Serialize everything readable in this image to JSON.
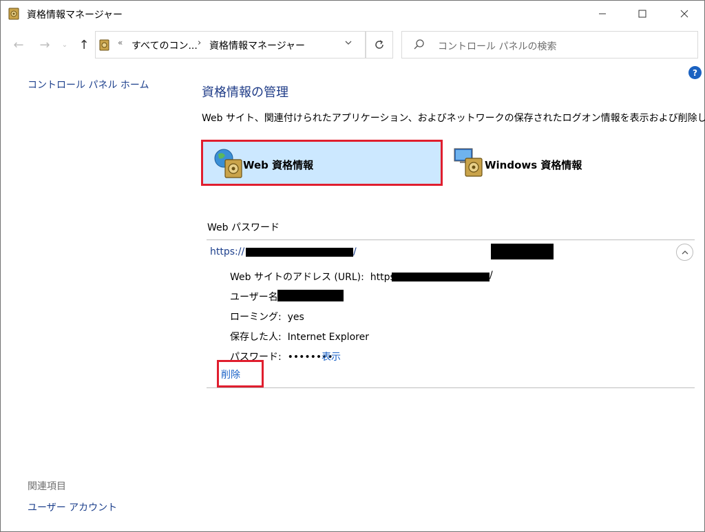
{
  "window": {
    "title": "資格情報マネージャー",
    "controls": {
      "minimize": "minimize",
      "maximize": "maximize",
      "close": "close"
    }
  },
  "address_bar": {
    "overflow_chevron": "«",
    "crumbs": [
      "すべてのコン...",
      "資格情報マネージャー"
    ],
    "separator": "›"
  },
  "search": {
    "placeholder": "コントロール パネルの検索"
  },
  "sidebar": {
    "home_link": "コントロール パネル ホーム",
    "related_title": "関連項目",
    "related_links": [
      "ユーザー アカウント"
    ]
  },
  "main": {
    "title": "資格情報の管理",
    "description": "Web サイト、関連付けられたアプリケーション、およびネットワークの保存されたログオン情報を表示および削除します。",
    "tiles": [
      {
        "label": "Web 資格情報",
        "selected": true,
        "icon": "globe-vault-icon"
      },
      {
        "label": "Windows 資格情報",
        "selected": false,
        "icon": "computer-vault-icon"
      }
    ],
    "section_title": "Web パスワード",
    "entry": {
      "url_prefix": "https://",
      "url_suffix": "/",
      "details": {
        "url_label": "Web サイトのアドレス (URL):",
        "url_value_prefix": "https://",
        "url_value_suffix": "/",
        "username_label": "ユーザー名:",
        "roaming_label": "ローミング:",
        "roaming_value": "yes",
        "saved_by_label": "保存した人:",
        "saved_by_value": "Internet Explorer",
        "password_label": "パスワード:",
        "password_mask": "••••••••",
        "show_link": "表示",
        "delete_link": "削除"
      }
    }
  },
  "colors": {
    "selected_tile_bg": "#cce8ff",
    "highlight_border": "#e01e2e",
    "link": "#1a62c7",
    "title": "#1e3b87"
  }
}
